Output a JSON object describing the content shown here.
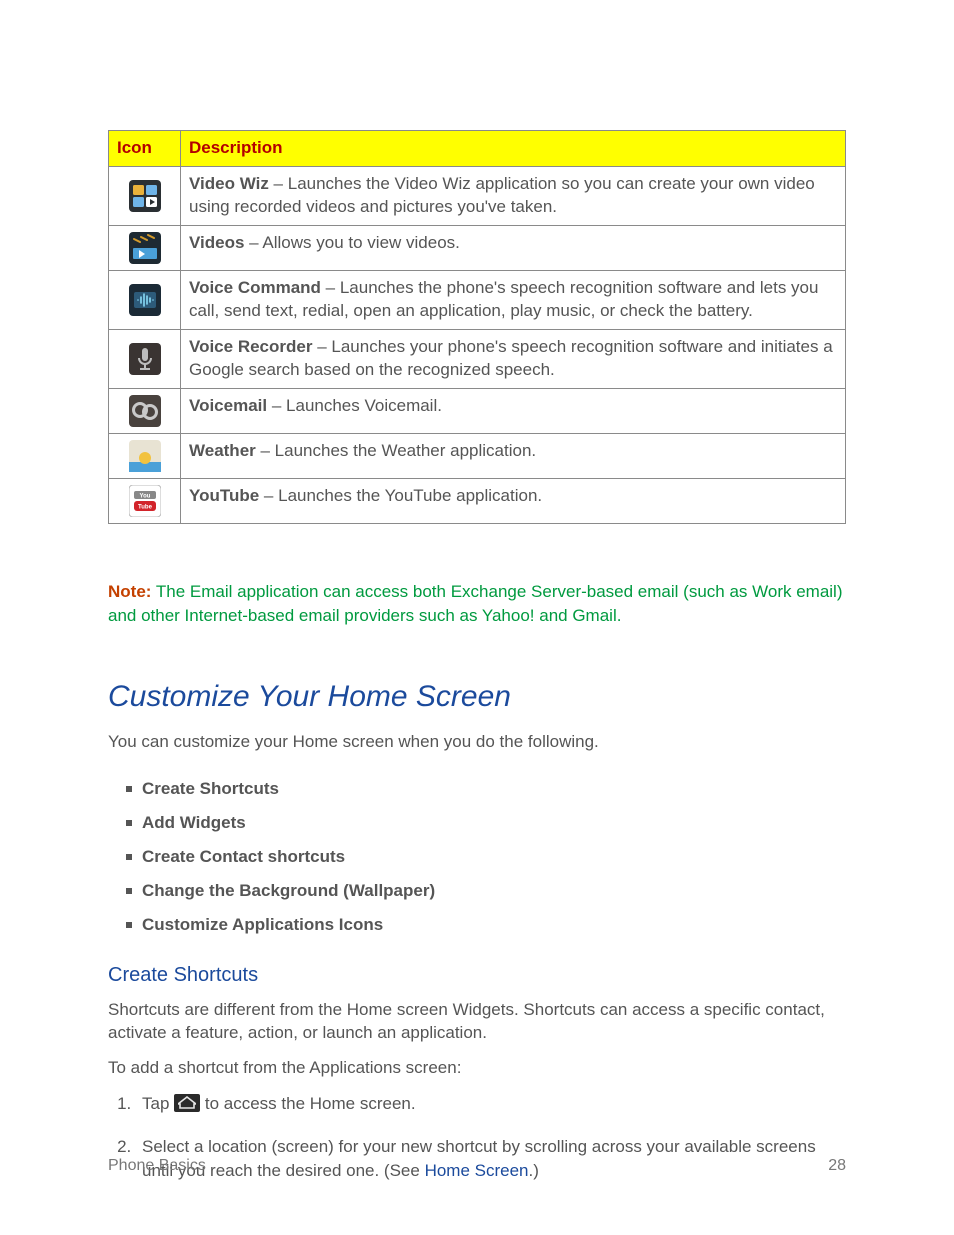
{
  "table": {
    "header_icon": "Icon",
    "header_desc": "Description",
    "rows": [
      {
        "icon": "video-wiz-icon",
        "title": "Video Wiz",
        "sep": " – ",
        "text": "Launches the Video Wiz application so you can create your own video using recorded videos and pictures you've taken."
      },
      {
        "icon": "videos-icon",
        "title": "Videos",
        "sep": " – ",
        "text": "Allows you to view videos."
      },
      {
        "icon": "voice-command-icon",
        "title": "Voice Command",
        "sep": " – ",
        "text": "Launches the phone's speech recognition software and lets you call, send text, redial, open an application, play music, or check the battery."
      },
      {
        "icon": "voice-recorder-icon",
        "title": "Voice Recorder",
        "sep": " – ",
        "text": "Launches your phone's speech recognition software and initiates a Google search based on the recognized speech."
      },
      {
        "icon": "voicemail-icon",
        "title": "Voicemail",
        "sep": " – ",
        "text": "Launches Voicemail."
      },
      {
        "icon": "weather-icon",
        "title": "Weather",
        "sep": " – ",
        "text": "Launches the Weather application."
      },
      {
        "icon": "youtube-icon",
        "title": "YouTube",
        "sep": " – ",
        "text": "Launches the YouTube application."
      }
    ]
  },
  "note": {
    "label": "Note:",
    "text": "  The Email application can access both Exchange Server-based email (such as Work email) and other Internet-based email providers such as Yahoo! and Gmail."
  },
  "section": {
    "title": "Customize Your Home Screen",
    "intro": "You can customize your Home screen when you do the following.",
    "bullets": [
      "Create Shortcuts",
      "Add Widgets",
      "Create Contact shortcuts",
      "Change the Background (Wallpaper)",
      "Customize Applications Icons"
    ],
    "sub_title": "Create Shortcuts",
    "sub_p1": "Shortcuts are different from the Home screen Widgets. Shortcuts can access a specific contact, activate a feature, action, or launch an application.",
    "sub_p2": "To add a shortcut from the Applications screen:",
    "steps": {
      "s1a": "Tap ",
      "s1b": " to access the Home screen.",
      "s2a": "Select a location (screen) for your new shortcut by scrolling across your available screens until you reach the desired one. (See ",
      "s2link": "Home Screen",
      "s2b": ".)"
    }
  },
  "footer": {
    "left": "Phone Basics",
    "right": "28"
  }
}
